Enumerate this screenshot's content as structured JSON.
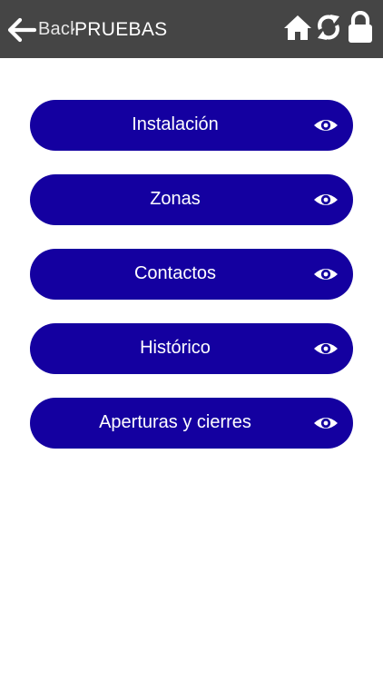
{
  "header": {
    "back_label": "Back",
    "title": "PRUEBAS",
    "icons": [
      "arrow-left-icon",
      "home-icon",
      "sync-icon",
      "lock-icon"
    ]
  },
  "menu": {
    "items": [
      {
        "label": "Instalación",
        "icon": "eye-icon"
      },
      {
        "label": "Zonas",
        "icon": "eye-icon"
      },
      {
        "label": "Contactos",
        "icon": "eye-icon"
      },
      {
        "label": "Histórico",
        "icon": "eye-icon"
      },
      {
        "label": "Aperturas y cierres",
        "icon": "eye-icon"
      }
    ]
  },
  "colors": {
    "header_bg": "#454545",
    "button_bg": "#1400a0",
    "text": "#ffffff"
  }
}
